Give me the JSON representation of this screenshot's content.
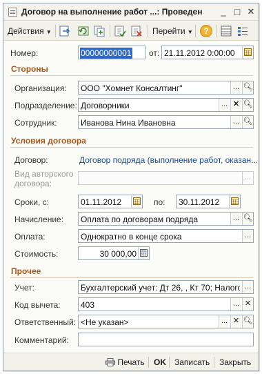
{
  "window": {
    "title": "Договор на выполнение работ ...: Проведен",
    "minimize": "_",
    "maximize": "□",
    "close": "✕"
  },
  "toolbar": {
    "actions_label": "Действия",
    "goto_label": "Перейти",
    "help_label": "?"
  },
  "header": {
    "number_label": "Номер:",
    "number_value": "00000000001",
    "from_label": "от:",
    "date_value": "21.11.2012 0:00:00"
  },
  "sections": {
    "parties": "Стороны",
    "contract_terms": "Условия договора",
    "other": "Прочее"
  },
  "fields": {
    "organization_label": "Организация:",
    "organization_value": "ООО \"Хомнет Консалтинг\"",
    "department_label": "Подразделение:",
    "department_value": "Договорники",
    "employee_label": "Сотрудник:",
    "employee_value": "Иванова Нина Ивановна",
    "contract_label": "Договор:",
    "contract_value": "Договор подряда (выполнение работ, оказан...",
    "author_type_label_1": "Вид авторского",
    "author_type_label_2": "договора:",
    "author_type_value": "",
    "period_from_label": "Сроки, с:",
    "period_from_value": "01.11.2012",
    "period_to_label": "по:",
    "period_to_value": "30.11.2012",
    "accrual_label": "Начисление:",
    "accrual_value": "Оплата по договорам подряда",
    "payment_label": "Оплата:",
    "payment_value": "Однократно в конце срока",
    "cost_label": "Стоимость:",
    "cost_value": "30 000,00",
    "accounting_label": "Учет:",
    "accounting_value": "Бухгалтерский учет: Дт 26, , Кт 70; Налого",
    "deduction_code_label": "Код вычета:",
    "deduction_code_value": "403",
    "responsible_label": "Ответственный:",
    "responsible_value": "<Не указан>",
    "comment_label": "Комментарий:",
    "comment_value": ""
  },
  "footer": {
    "print_label": "Печать",
    "ok_label": "OK",
    "save_label": "Записать",
    "close_label": "Закрыть"
  },
  "colors": {
    "section_heading": "#a8571b",
    "link": "#1a4d95",
    "selection": "#3169c6"
  }
}
